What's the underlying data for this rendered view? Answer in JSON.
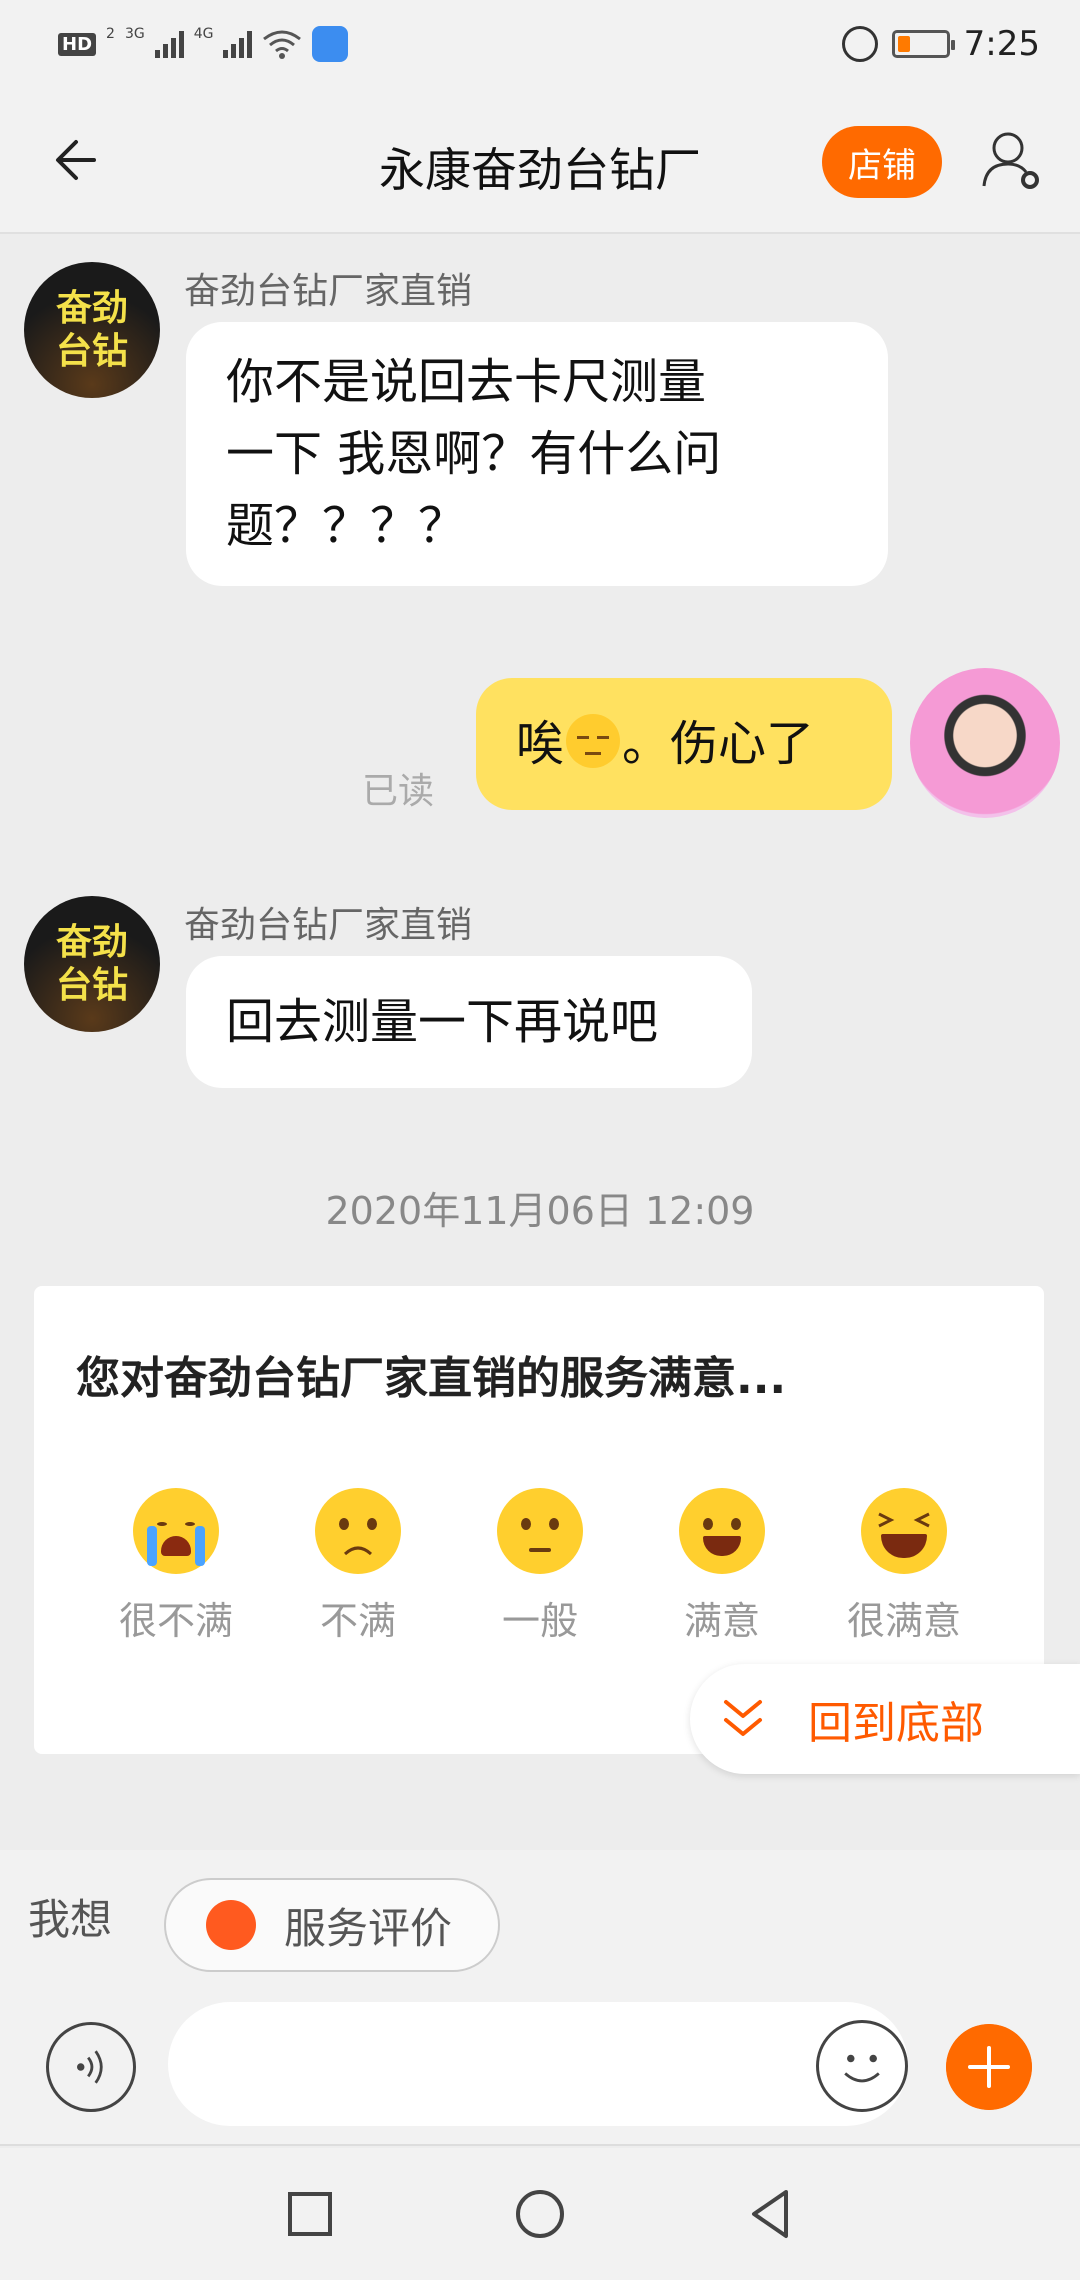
{
  "status_bar": {
    "hd": "HD",
    "hd_sub": "2",
    "sig1": "3G",
    "sig2": "4G",
    "time": "7:25"
  },
  "header": {
    "title": "永康奋劲台钻厂",
    "shop_label": "店铺"
  },
  "chat": {
    "messages": [
      {
        "sender": "奋劲台钻厂家直销",
        "avatar_text": "奋劲台钻",
        "text": "你不是说回去卡尺测量\n一下 我恩啊？有什么问\n题？？？？"
      },
      {
        "mine": true,
        "text_before": "唉",
        "emoji": "pensive-face",
        "text_after": "。伤心了",
        "read": "已读"
      },
      {
        "sender": "奋劲台钻厂家直销",
        "avatar_text": "奋劲台钻",
        "text": "回去测量一下再说吧"
      }
    ],
    "timestamp": "2020年11月06日 12:09"
  },
  "survey": {
    "title": "您对奋劲台钻厂家直销的服务满意...",
    "ratings": [
      {
        "label": "很不满",
        "icon": "crying-face"
      },
      {
        "label": "不满",
        "icon": "frowning-face"
      },
      {
        "label": "一般",
        "icon": "neutral-face"
      },
      {
        "label": "满意",
        "icon": "smiling-face"
      },
      {
        "label": "很满意",
        "icon": "laughing-face"
      }
    ]
  },
  "back_to_bottom": "回到底部",
  "quickbar": {
    "label": "我想",
    "chip": "服务评价"
  },
  "input": {
    "placeholder": "",
    "value": ""
  },
  "colors": {
    "accent": "#ff6a00",
    "my_bubble": "#ffe160",
    "background": "#ededed"
  }
}
